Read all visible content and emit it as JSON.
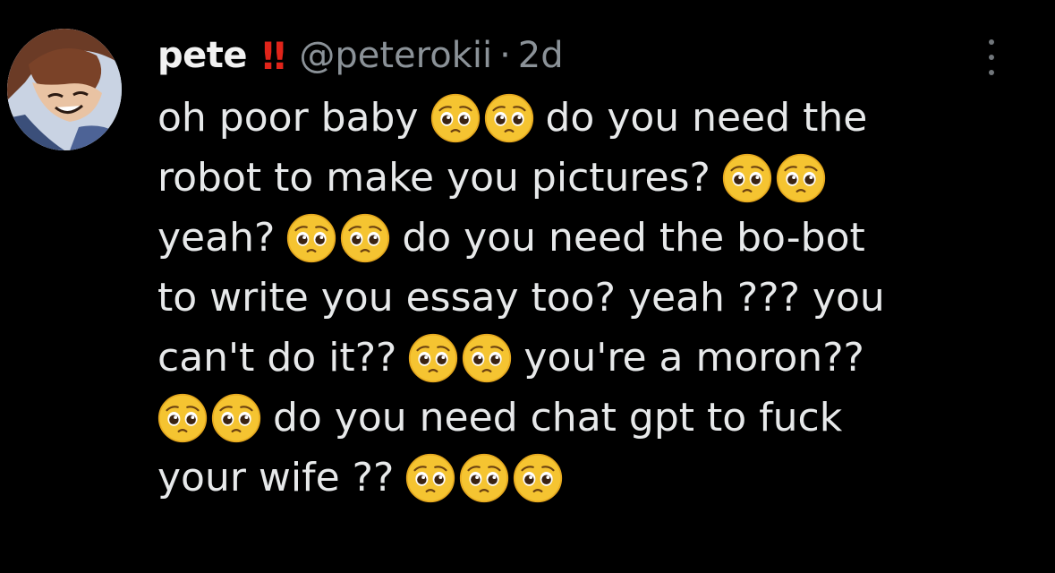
{
  "user": {
    "display_name": "pete",
    "badge": "!!",
    "handle": "@peterokii",
    "separator": "·",
    "time": "2d"
  },
  "tweet": {
    "lines": [
      {
        "parts": [
          "oh poor baby",
          "do you need the"
        ]
      },
      {
        "parts": [
          "robot to make you pictures?"
        ]
      },
      {
        "parts": [
          "yeah?",
          "do you need the bo-bot"
        ]
      },
      {
        "parts": [
          "to write you essay too? yeah ??? you"
        ]
      },
      {
        "parts": [
          "can't do it??",
          "you're a moron??"
        ]
      },
      {
        "parts": [
          "do you need chat gpt to fu",
          "ck"
        ]
      },
      {
        "parts": [
          "your wife ??"
        ]
      }
    ]
  },
  "emoji": {
    "name": "pleading-face",
    "face_color": "#f5c431",
    "face_edge": "#e6a91f"
  },
  "icons": {
    "more": "more-vertical-icon",
    "avatar": "avatar"
  },
  "colors": {
    "background": "#000000",
    "text": "#e7e9ea",
    "muted": "#8b9298",
    "badge": "#e0241a"
  }
}
